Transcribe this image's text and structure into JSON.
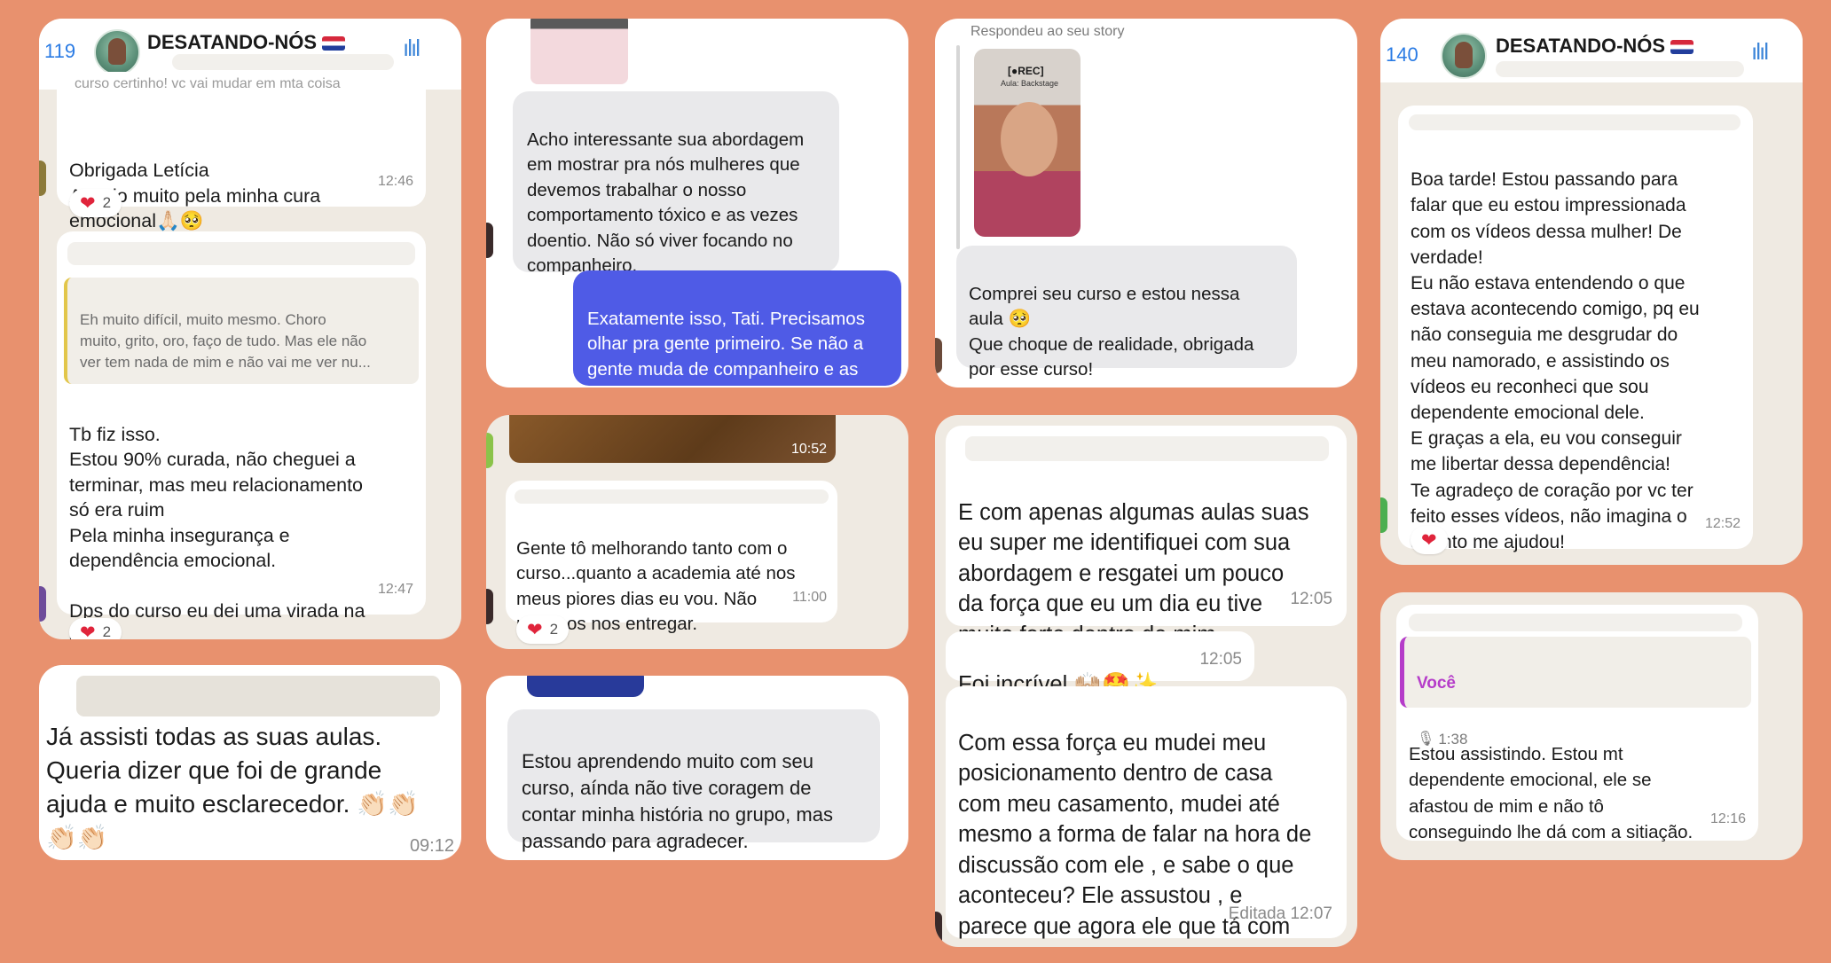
{
  "colors": {
    "background": "#E8916E",
    "accent_purple": "#4F5BE6",
    "heart": "#E0243B",
    "voice_label": "#B53CC9"
  },
  "card1": {
    "header": {
      "count": "119",
      "title": "DESATANDO-NÓS",
      "icon": "waveform-icon"
    },
    "faded_text": "curso certinho! vc vai mudar em mta coisa",
    "msg1": {
      "text": "Obrigada Letícia\nAnseio muito pela minha cura\nemocional🙏🏻🥺",
      "time": "12:46"
    },
    "reaction1": {
      "emoji": "❤️",
      "count": "2"
    },
    "quote": "Eh muito difícil, muito mesmo. Choro\nmuito, grito, oro, faço de tudo. Mas ele não\nver tem nada de mim e não vai me ver nu...",
    "msg2": {
      "text": "Tb fiz isso.\nEstou 90% curada, não cheguei a\nterminar, mas meu relacionamento\nsó era ruim\nPela minha insegurança e\ndependência emocional.\n\nDps do curso eu dei uma virada na\nchave",
      "time": "12:47"
    },
    "reaction2": {
      "emoji": "❤️",
      "count": "2"
    }
  },
  "card2": {
    "text": "Já assisti todas as suas aulas.\nQueria dizer que foi de grande\najuda e muito esclarecedor. 👏🏻👏🏻\n👏🏻👏🏻",
    "time": "09:12"
  },
  "card3": {
    "received": "Acho interessante sua abordagem\nem mostrar pra nós mulheres que\ndevemos trabalhar o nosso\ncomportamento tóxico e as vezes\ndoentio. Não só viver focando no\ncompanheiro.",
    "sent": "Exatamente isso, Tati. Precisamos\nolhar pra gente primeiro. Se não a\ngente muda de companheiro e as\nsituações não mudam."
  },
  "card4": {
    "media_time": "10:52",
    "msg": {
      "text": "Gente tô melhorando tanto com o\ncurso...quanto a academia até nos\nmeus piores dias eu vou. Não\npodenos nos entregar.",
      "time": "11:00"
    },
    "reaction": {
      "emoji": "❤️",
      "count": "2"
    }
  },
  "card5": {
    "text": "Estou aprendendo muito com seu\ncurso, aínda não tive coragem de\ncontar minha história no grupo, mas\npassando para agradecer."
  },
  "card6": {
    "story_label": "Respondeu ao seu story",
    "story_badge": "[●REC]",
    "story_caption": "Aula: Backstage",
    "msg": "Comprei seu curso e estou nessa\naula 🥺\nQue choque de realidade, obrigada\npor esse curso!"
  },
  "card7": {
    "msg1": {
      "text": "E com apenas algumas aulas suas\neu super me identifiquei com sua\nabordagem e resgatei um pouco\nda força que eu um dia eu tive\nmuito forte dentro de mim",
      "time": "12:05"
    },
    "msg2": {
      "text": "Foi incrível 🙌🏼🤩✨",
      "time": "12:05"
    },
    "msg3": {
      "text": "Com essa força eu mudei meu\nposicionamento dentro de casa\ncom meu casamento, mudei até\nmesmo a forma de falar na hora de\ndiscussão com ele , e sabe o que\naconteceu? Ele assustou , e\nparece que agora ele que tá com\nmedo de eu ir embora",
      "time": "Editada 12:07"
    }
  },
  "card8": {
    "header": {
      "count": "140",
      "title": "DESATANDO-NÓS",
      "icon": "waveform-icon"
    },
    "msg": {
      "text": "Boa tarde! Estou passando para\nfalar que eu estou impressionada\ncom os vídeos dessa mulher! De\nverdade!\nEu não estava entendendo o que\nestava acontecendo comigo, pq eu\nnão conseguia me desgrudar do\nmeu namorado, e assistindo os\nvídeos eu reconheci que sou\ndependente emocional dele.\nE graças a ela, eu vou conseguir\nme libertar dessa dependência!\nTe agradeço de coração por vc ter\nfeito esses vídeos, não imagina o\nquanto me ajudou!",
      "time": "12:52"
    },
    "reaction": {
      "emoji": "❤️"
    }
  },
  "card9": {
    "reply_author": "Você",
    "reply_duration": "1:38",
    "msg": {
      "text": "Estou assistindo. Estou mt\ndependente emocional, ele se\nafastou de mim e não tô\nconseguindo lhe dá com a sitiação.",
      "time": "12:16"
    }
  }
}
